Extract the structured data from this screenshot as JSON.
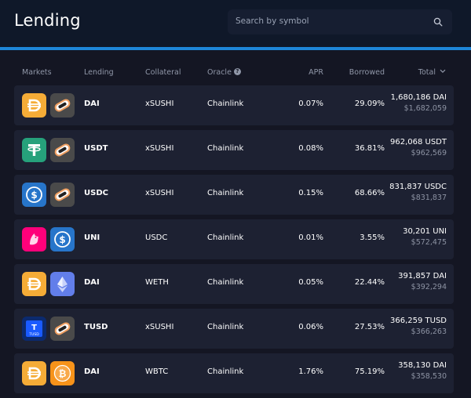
{
  "header": {
    "title": "Lending",
    "search_placeholder": "Search by symbol"
  },
  "columns": {
    "markets": "Markets",
    "lending": "Lending",
    "collateral": "Collateral",
    "oracle": "Oracle",
    "apr": "APR",
    "borrowed": "Borrowed",
    "total": "Total"
  },
  "colors": {
    "dai": "#f5ac37",
    "usdt": "#26a17b",
    "usdc": "#2775ca",
    "uni": "#ff007a",
    "weth": "#627eea",
    "tusd": "#1a5aff",
    "wbtc": "#f7931a",
    "sushi": "#4a4a4a"
  },
  "rows": [
    {
      "asset_icon": "dai-icon",
      "collateral_icon": "xsushi-icon",
      "lending": "DAI",
      "collateral": "xSUSHI",
      "oracle": "Chainlink",
      "apr": "0.07%",
      "borrowed": "29.09%",
      "total": "1,680,186 DAI",
      "total_usd": "$1,682,059"
    },
    {
      "asset_icon": "usdt-icon",
      "collateral_icon": "xsushi-icon",
      "lending": "USDT",
      "collateral": "xSUSHI",
      "oracle": "Chainlink",
      "apr": "0.08%",
      "borrowed": "36.81%",
      "total": "962,068 USDT",
      "total_usd": "$962,569"
    },
    {
      "asset_icon": "usdc-icon",
      "collateral_icon": "xsushi-icon",
      "lending": "USDC",
      "collateral": "xSUSHI",
      "oracle": "Chainlink",
      "apr": "0.15%",
      "borrowed": "68.66%",
      "total": "831,837 USDC",
      "total_usd": "$831,837"
    },
    {
      "asset_icon": "uni-icon",
      "collateral_icon": "usdc-icon",
      "lending": "UNI",
      "collateral": "USDC",
      "oracle": "Chainlink",
      "apr": "0.01%",
      "borrowed": "3.55%",
      "total": "30,201 UNI",
      "total_usd": "$572,475"
    },
    {
      "asset_icon": "dai-icon",
      "collateral_icon": "weth-icon",
      "lending": "DAI",
      "collateral": "WETH",
      "oracle": "Chainlink",
      "apr": "0.05%",
      "borrowed": "22.44%",
      "total": "391,857 DAI",
      "total_usd": "$392,294"
    },
    {
      "asset_icon": "tusd-icon",
      "collateral_icon": "xsushi-icon",
      "lending": "TUSD",
      "collateral": "xSUSHI",
      "oracle": "Chainlink",
      "apr": "0.06%",
      "borrowed": "27.53%",
      "total": "366,259 TUSD",
      "total_usd": "$366,263"
    },
    {
      "asset_icon": "dai-icon",
      "collateral_icon": "wbtc-icon",
      "lending": "DAI",
      "collateral": "WBTC",
      "oracle": "Chainlink",
      "apr": "1.76%",
      "borrowed": "75.19%",
      "total": "358,130 DAI",
      "total_usd": "$358,530"
    }
  ]
}
